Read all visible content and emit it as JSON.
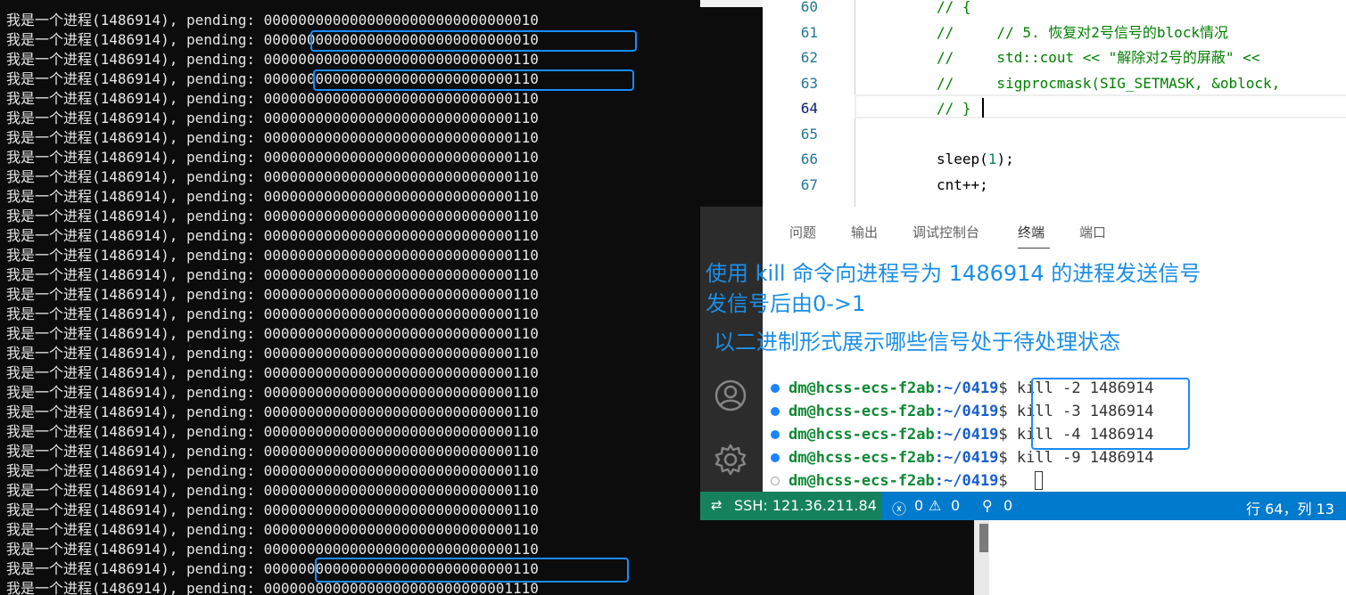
{
  "left_terminal": {
    "lines": [
      "我是一个进程(1486914), pending: 00000000000000000000000000000010",
      "我是一个进程(1486914), pending: 00000000000000000000000000000010",
      "我是一个进程(1486914), pending: 00000000000000000000000000000110",
      "我是一个进程(1486914), pending: 00000000000000000000000000000110",
      "我是一个进程(1486914), pending: 00000000000000000000000000000110",
      "我是一个进程(1486914), pending: 00000000000000000000000000000110",
      "我是一个进程(1486914), pending: 00000000000000000000000000000110",
      "我是一个进程(1486914), pending: 00000000000000000000000000000110",
      "我是一个进程(1486914), pending: 00000000000000000000000000000110",
      "我是一个进程(1486914), pending: 00000000000000000000000000000110",
      "我是一个进程(1486914), pending: 00000000000000000000000000000110",
      "我是一个进程(1486914), pending: 00000000000000000000000000000110",
      "我是一个进程(1486914), pending: 00000000000000000000000000000110",
      "我是一个进程(1486914), pending: 00000000000000000000000000000110",
      "我是一个进程(1486914), pending: 00000000000000000000000000000110",
      "我是一个进程(1486914), pending: 00000000000000000000000000000110",
      "我是一个进程(1486914), pending: 00000000000000000000000000000110",
      "我是一个进程(1486914), pending: 00000000000000000000000000000110",
      "我是一个进程(1486914), pending: 00000000000000000000000000000110",
      "我是一个进程(1486914), pending: 00000000000000000000000000000110",
      "我是一个进程(1486914), pending: 00000000000000000000000000000110",
      "我是一个进程(1486914), pending: 00000000000000000000000000000110",
      "我是一个进程(1486914), pending: 00000000000000000000000000000110",
      "我是一个进程(1486914), pending: 00000000000000000000000000000110",
      "我是一个进程(1486914), pending: 00000000000000000000000000000110",
      "我是一个进程(1486914), pending: 00000000000000000000000000000110",
      "我是一个进程(1486914), pending: 00000000000000000000000000000110",
      "我是一个进程(1486914), pending: 00000000000000000000000000000110",
      "我是一个进程(1486914), pending: 00000000000000000000000000000110",
      "我是一个进程(1486914), pending: 00000000000000000000000000001110"
    ]
  },
  "editor": {
    "line_numbers": [
      "60",
      "61",
      "62",
      "63",
      "64",
      "65",
      "66",
      "67"
    ],
    "code": [
      "// {",
      "//     // 5. 恢复对2号信号的block情况",
      "//     std::cout << \"解除对2号的屏蔽\" <<",
      "//     sigprocmask(SIG_SETMASK, &oblock,",
      "// }",
      "",
      "sleep(1);",
      "cnt++;"
    ]
  },
  "panel_tabs": [
    "问题",
    "输出",
    "调试控制台",
    "终端",
    "端口"
  ],
  "annotations": {
    "line1": "使用 kill 命令向进程号为 1486914 的进程发送信号",
    "line2": "发信号后由0->1",
    "line3": "以二进制形式展示哪些信号处于待处理状态"
  },
  "terminal": {
    "user_host": "dm@hcss-ecs-f2ab",
    "path": ":~/0419",
    "prompt_symbol": "$",
    "commands": [
      "kill -2 1486914",
      "kill -3 1486914",
      "kill -4 1486914",
      "kill -9 1486914",
      ""
    ]
  },
  "status_bar": {
    "remote": "SSH: 121.36.211.84",
    "errors": "0",
    "warnings": "0",
    "ports": "0",
    "position": "行 64，列 13"
  },
  "colors": {
    "highlight": "#1a8cff",
    "status_bar": "#007acc",
    "remote": "#16825d",
    "annotation": "#1b8ee6"
  }
}
